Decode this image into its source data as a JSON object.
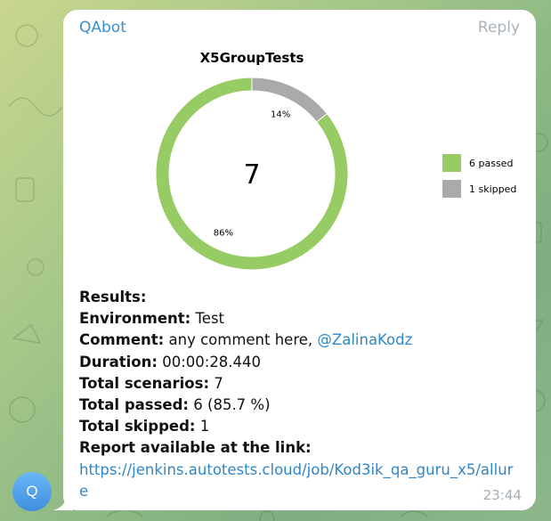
{
  "message": {
    "sender": "QAbot",
    "reply_label": "Reply",
    "time": "23:44",
    "avatar_letter": "Q"
  },
  "chart_data": {
    "type": "pie",
    "title": "X5GroupTests",
    "center_label": "7",
    "categories": [
      "passed",
      "skipped"
    ],
    "values": [
      6,
      1
    ],
    "slice_labels": [
      "86%",
      "14%"
    ],
    "legend": [
      "6 passed",
      "1 skipped"
    ],
    "legend_position": "right",
    "colors": [
      "#97cc64",
      "#aaaaaa"
    ]
  },
  "results": {
    "heading": "Results:",
    "environment_label": "Environment:",
    "environment_value": "Test",
    "comment_label": "Comment:",
    "comment_value": "any comment here,",
    "comment_mention": "@ZalinaKodz",
    "duration_label": "Duration:",
    "duration_value": "00:00:28.440",
    "scenarios_label": "Total scenarios:",
    "scenarios_value": "7",
    "passed_label": "Total passed:",
    "passed_value": "6 (85.7 %)",
    "skipped_label": "Total skipped:",
    "skipped_value": "1",
    "report_label": "Report available at the link:",
    "report_url": "https://jenkins.autotests.cloud/job/Kod3ik_qa_guru_x5/allure"
  },
  "colors": {
    "link": "#2f87c8",
    "sender": "#3a8fd0"
  }
}
